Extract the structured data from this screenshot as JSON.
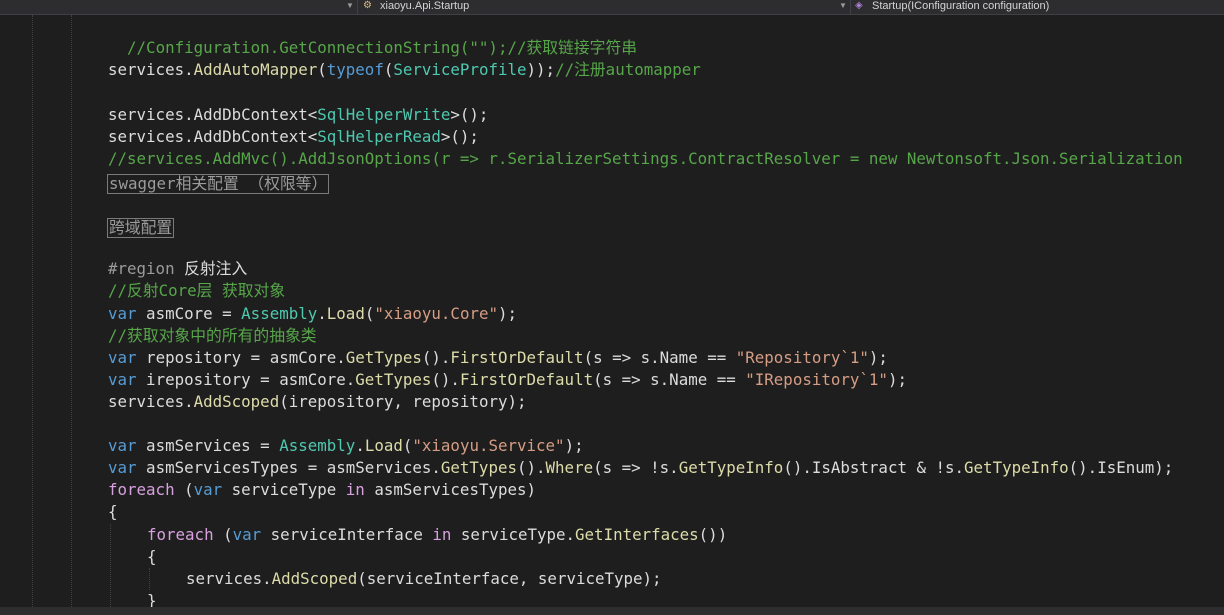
{
  "navbar": {
    "type_dropdown": "xiaoyu.Api.Startup",
    "member_dropdown": "Startup(IConfiguration configuration)"
  },
  "code": {
    "l1": "//Configuration.GetConnectionString(\"\");//获取链接字符串",
    "l2_a": "services",
    "l2_b": ".",
    "l2_c": "AddAutoMapper",
    "l2_d": "(",
    "l2_e": "typeof",
    "l2_f": "(",
    "l2_g": "ServiceProfile",
    "l2_h": "));",
    "l2_i": "//注册automapper",
    "l3_a": "services.AddDbContext<",
    "l3_b": "SqlHelperWrite",
    "l3_c": ">();",
    "l4_a": "services.AddDbContext<",
    "l4_b": "SqlHelperRead",
    "l4_c": ">();",
    "l5": "//services.AddMvc().AddJsonOptions(r => r.SerializerSettings.ContractResolver = new Newtonsoft.Json.Serialization",
    "region1": "swagger相关配置 （权限等）",
    "region2": "跨域配置",
    "l6_a": "#region",
    "l6_b": " 反射注入",
    "l7": "//反射Core层 获取对象",
    "l8_a": "var",
    "l8_b": " asmCore = ",
    "l8_c": "Assembly",
    "l8_d": ".",
    "l8_e": "Load",
    "l8_f": "(",
    "l8_g": "\"xiaoyu.Core\"",
    "l8_h": ");",
    "l9": "//获取对象中的所有的抽象类",
    "l10_a": "var",
    "l10_b": " repository = asmCore.",
    "l10_c": "GetTypes",
    "l10_d": "().",
    "l10_e": "FirstOrDefault",
    "l10_f": "(s => s.Name == ",
    "l10_g": "\"Repository`1\"",
    "l10_h": ");",
    "l11_a": "var",
    "l11_b": " irepository = asmCore.",
    "l11_c": "GetTypes",
    "l11_d": "().",
    "l11_e": "FirstOrDefault",
    "l11_f": "(s => s.Name == ",
    "l11_g": "\"IRepository`1\"",
    "l11_h": ");",
    "l12_a": "services.",
    "l12_b": "AddScoped",
    "l12_c": "(irepository, repository);",
    "l13_a": "var",
    "l13_b": " asmServices = ",
    "l13_c": "Assembly",
    "l13_d": ".",
    "l13_e": "Load",
    "l13_f": "(",
    "l13_g": "\"xiaoyu.Service\"",
    "l13_h": ");",
    "l14_a": "var",
    "l14_b": " asmServicesTypes = asmServices.",
    "l14_c": "GetTypes",
    "l14_d": "().",
    "l14_e": "Where",
    "l14_f": "(s => !s.",
    "l14_g": "GetTypeInfo",
    "l14_h": "().IsAbstract & !s.",
    "l14_i": "GetTypeInfo",
    "l14_j": "().IsEnum);",
    "l15_a": "foreach",
    "l15_b": " (",
    "l15_c": "var",
    "l15_d": " serviceType ",
    "l15_e": "in",
    "l15_f": " asmServicesTypes)",
    "l16": "{",
    "l17_a": "foreach",
    "l17_b": " (",
    "l17_c": "var",
    "l17_d": " serviceInterface ",
    "l17_e": "in",
    "l17_f": " serviceType.",
    "l17_g": "GetInterfaces",
    "l17_h": "())",
    "l18": "{",
    "l19_a": "services.",
    "l19_b": "AddScoped",
    "l19_c": "(serviceInterface, serviceType);",
    "l20": "}"
  }
}
